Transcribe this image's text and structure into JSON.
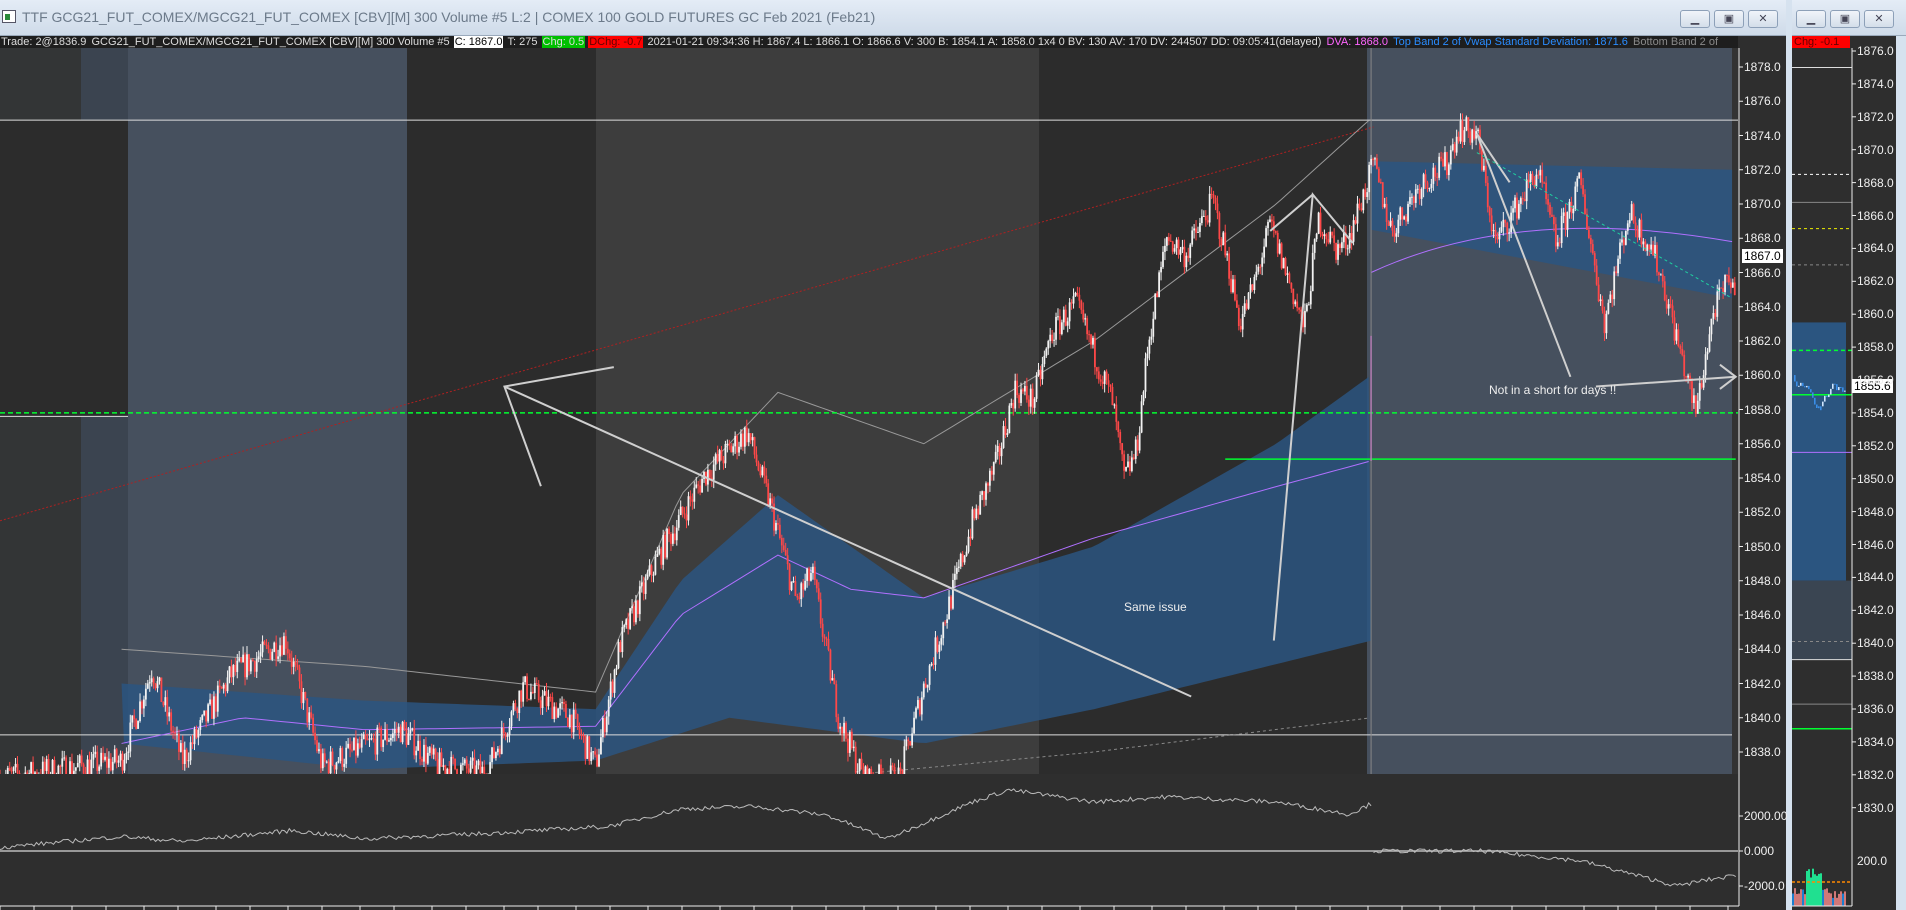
{
  "main_window": {
    "title": "TTF GCG21_FUT_COMEX/MGCG21_FUT_COMEX [CBV][M]  300 Volume  #5 L:2 | COMEX 100 GOLD FUTURES GC Feb 2021 (Feb21)",
    "buttons": {
      "minimize": "▁",
      "restore": "▣",
      "close": "✕"
    },
    "info": {
      "trade": "Trade: 2@1836.9",
      "symbol": "GCG21_FUT_COMEX/MGCG21_FUT_COMEX [CBV][M]  300 Volume  #5",
      "close": "C: 1867.0",
      "ticks": "T: 275",
      "chg": "Chg: 0.5",
      "dchg": "DChg: -0.7",
      "details": "2021-01-21 09:34:36 H: 1867.4 L: 1866.1 O: 1866.6 V: 300 B: 1854.1 A: 1858.0 1x4 0 BV: 130 AV: 170 DV: 244507 DD: 09:05:41(delayed)",
      "dva": "DVA: 1868.0",
      "top_band": "Top Band 2 of Vwap Standard Deviation: 1871.6",
      "bottom_band": "Bottom Band 2 of"
    },
    "current_price_label": "1867.0",
    "annotations": {
      "same_issue": "Same issue",
      "not_short": "Not in a short for days !!"
    },
    "price_axis": [
      "1878.0",
      "1876.0",
      "1874.0",
      "1872.0",
      "1870.0",
      "1868.0",
      "1866.0",
      "1864.0",
      "1862.0",
      "1860.0",
      "1858.0",
      "1856.0",
      "1854.0",
      "1852.0",
      "1850.0",
      "1848.0",
      "1846.0",
      "1844.0",
      "1842.0",
      "1840.0",
      "1838.0"
    ],
    "lower_axis": [
      "2000.00",
      "0.000",
      "-2000.0"
    ]
  },
  "side_window": {
    "buttons": {
      "minimize": "▁",
      "restore": "▣",
      "close": "✕"
    },
    "chg": "Chg: -0.1",
    "current_price_label": "1855.6",
    "price_axis": [
      "1876.0",
      "1874.0",
      "1872.0",
      "1870.0",
      "1868.0",
      "1866.0",
      "1864.0",
      "1862.0",
      "1860.0",
      "1858.0",
      "1856.0",
      "1854.0",
      "1852.0",
      "1850.0",
      "1848.0",
      "1846.0",
      "1844.0",
      "1842.0",
      "1840.0",
      "1838.0",
      "1836.0",
      "1834.0",
      "1832.0",
      "1830.0"
    ],
    "lower_axis": [
      "200.0"
    ]
  },
  "colors": {
    "up": "#f2f2f2",
    "down": "#ff4848",
    "vwap": "#b070ff",
    "band": "#2b5580",
    "green": "#00ff30",
    "trend": "#b02020"
  },
  "chart_data": {
    "type": "candlestick",
    "price_ylim": [
      1837,
      1879
    ],
    "x_range": [
      0,
      1428
    ],
    "price_path": [
      [
        0,
        1836.5
      ],
      [
        100,
        1837.5
      ],
      [
        125,
        1842.9
      ],
      [
        150,
        1837.5
      ],
      [
        190,
        1842.5
      ],
      [
        235,
        1844.6
      ],
      [
        265,
        1837.2
      ],
      [
        330,
        1839.3
      ],
      [
        360,
        1837.2
      ],
      [
        400,
        1836.8
      ],
      [
        430,
        1841.8
      ],
      [
        470,
        1840.0
      ],
      [
        490,
        1837.2
      ],
      [
        510,
        1844.3
      ],
      [
        540,
        1849.2
      ],
      [
        580,
        1854.2
      ],
      [
        615,
        1856.7
      ],
      [
        635,
        1852.1
      ],
      [
        655,
        1846.8
      ],
      [
        668,
        1848.5
      ],
      [
        690,
        1840.0
      ],
      [
        710,
        1836.5
      ],
      [
        740,
        1836.5
      ],
      [
        760,
        1841.8
      ],
      [
        780,
        1846.4
      ],
      [
        800,
        1851.4
      ],
      [
        820,
        1854.9
      ],
      [
        835,
        1859.2
      ],
      [
        850,
        1858.5
      ],
      [
        865,
        1862.4
      ],
      [
        885,
        1864.2
      ],
      [
        900,
        1861.3
      ],
      [
        915,
        1858.5
      ],
      [
        925,
        1853.9
      ],
      [
        935,
        1855.6
      ],
      [
        945,
        1862.0
      ],
      [
        960,
        1868.1
      ],
      [
        975,
        1867.0
      ],
      [
        998,
        1870.2
      ],
      [
        1010,
        1866.6
      ],
      [
        1020,
        1863.1
      ],
      [
        1030,
        1864.9
      ],
      [
        1045,
        1868.8
      ],
      [
        1060,
        1865.6
      ],
      [
        1073,
        1862.7
      ],
      [
        1085,
        1869.1
      ],
      [
        1100,
        1867.3
      ],
      [
        1110,
        1868.1
      ],
      [
        1130,
        1872.3
      ],
      [
        1145,
        1868.4
      ],
      [
        1170,
        1871.3
      ],
      [
        1190,
        1872.3
      ],
      [
        1200,
        1874.4
      ],
      [
        1215,
        1874.1
      ],
      [
        1230,
        1867.7
      ],
      [
        1245,
        1869.5
      ],
      [
        1265,
        1872.0
      ],
      [
        1280,
        1867.7
      ],
      [
        1300,
        1871.3
      ],
      [
        1320,
        1863.1
      ],
      [
        1340,
        1869.5
      ],
      [
        1360,
        1867.3
      ],
      [
        1370,
        1864.9
      ],
      [
        1385,
        1860.6
      ],
      [
        1395,
        1857.8
      ],
      [
        1410,
        1863.8
      ],
      [
        1425,
        1865.9
      ],
      [
        1428,
        1863.4
      ]
    ],
    "delta_path": [
      [
        0,
        200
      ],
      [
        100,
        830
      ],
      [
        150,
        550
      ],
      [
        240,
        1170
      ],
      [
        300,
        700
      ],
      [
        400,
        1000
      ],
      [
        500,
        1400
      ],
      [
        560,
        2400
      ],
      [
        620,
        2550
      ],
      [
        680,
        2050
      ],
      [
        730,
        700
      ],
      [
        800,
        2800
      ],
      [
        830,
        3500
      ],
      [
        900,
        2800
      ],
      [
        960,
        3100
      ],
      [
        1050,
        2800
      ],
      [
        1110,
        2100
      ],
      [
        1128,
        2700
      ],
      [
        1130,
        0
      ],
      [
        1220,
        0
      ],
      [
        1300,
        -550
      ],
      [
        1380,
        -2000
      ],
      [
        1400,
        -1700
      ],
      [
        1428,
        -1400
      ]
    ],
    "levels": {
      "green_dashed": 1857.8,
      "green_solid": 1855.1,
      "box_top": 1874.9,
      "box_bottom": 1839.0,
      "left_box_mid": 1857.6
    }
  }
}
